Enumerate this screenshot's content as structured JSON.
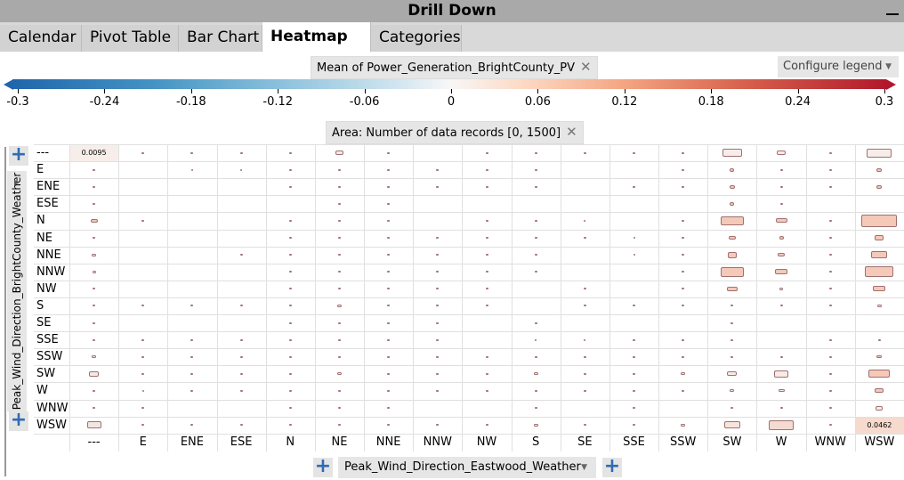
{
  "window": {
    "title": "Drill Down"
  },
  "tabs": [
    {
      "label": "Calendar",
      "active": false
    },
    {
      "label": "Pivot Table",
      "active": false
    },
    {
      "label": "Bar Chart",
      "active": false
    },
    {
      "label": "Heatmap",
      "active": true
    },
    {
      "label": "Categories",
      "active": false
    }
  ],
  "legend": {
    "color_chip": "Mean of Power_Generation_BrightCounty_PV",
    "configure_label": "Configure legend",
    "ticks": [
      "-0.3",
      "-0.24",
      "-0.18",
      "-0.12",
      "-0.06",
      "0",
      "0.06",
      "0.12",
      "0.18",
      "0.24",
      "0.3"
    ],
    "colors": {
      "low": "#2166ac",
      "mid": "#f7f7f7",
      "high": "#b2182b"
    }
  },
  "area_chip": "Area:  Number of data records  [0, 1500]",
  "y_axis_title": "Peak_Wind_Direction_BrightCounty_Weather",
  "x_axis_title": "Peak_Wind_Direction_Eastwood_Weather",
  "rows": [
    "---",
    "E",
    "ENE",
    "ESE",
    "N",
    "NE",
    "NNE",
    "NNW",
    "NW",
    "S",
    "SE",
    "SSE",
    "SSW",
    "SW",
    "W",
    "WNW",
    "WSW"
  ],
  "cols": [
    "---",
    "E",
    "ENE",
    "ESE",
    "N",
    "NE",
    "NNE",
    "NNW",
    "NW",
    "S",
    "SE",
    "SSE",
    "SSW",
    "SW",
    "W",
    "WNW",
    "WSW"
  ],
  "cell_labels": [
    {
      "row": 0,
      "col": 0,
      "text": "0.0095"
    },
    {
      "row": 16,
      "col": 16,
      "text": "0.0462"
    }
  ]
}
